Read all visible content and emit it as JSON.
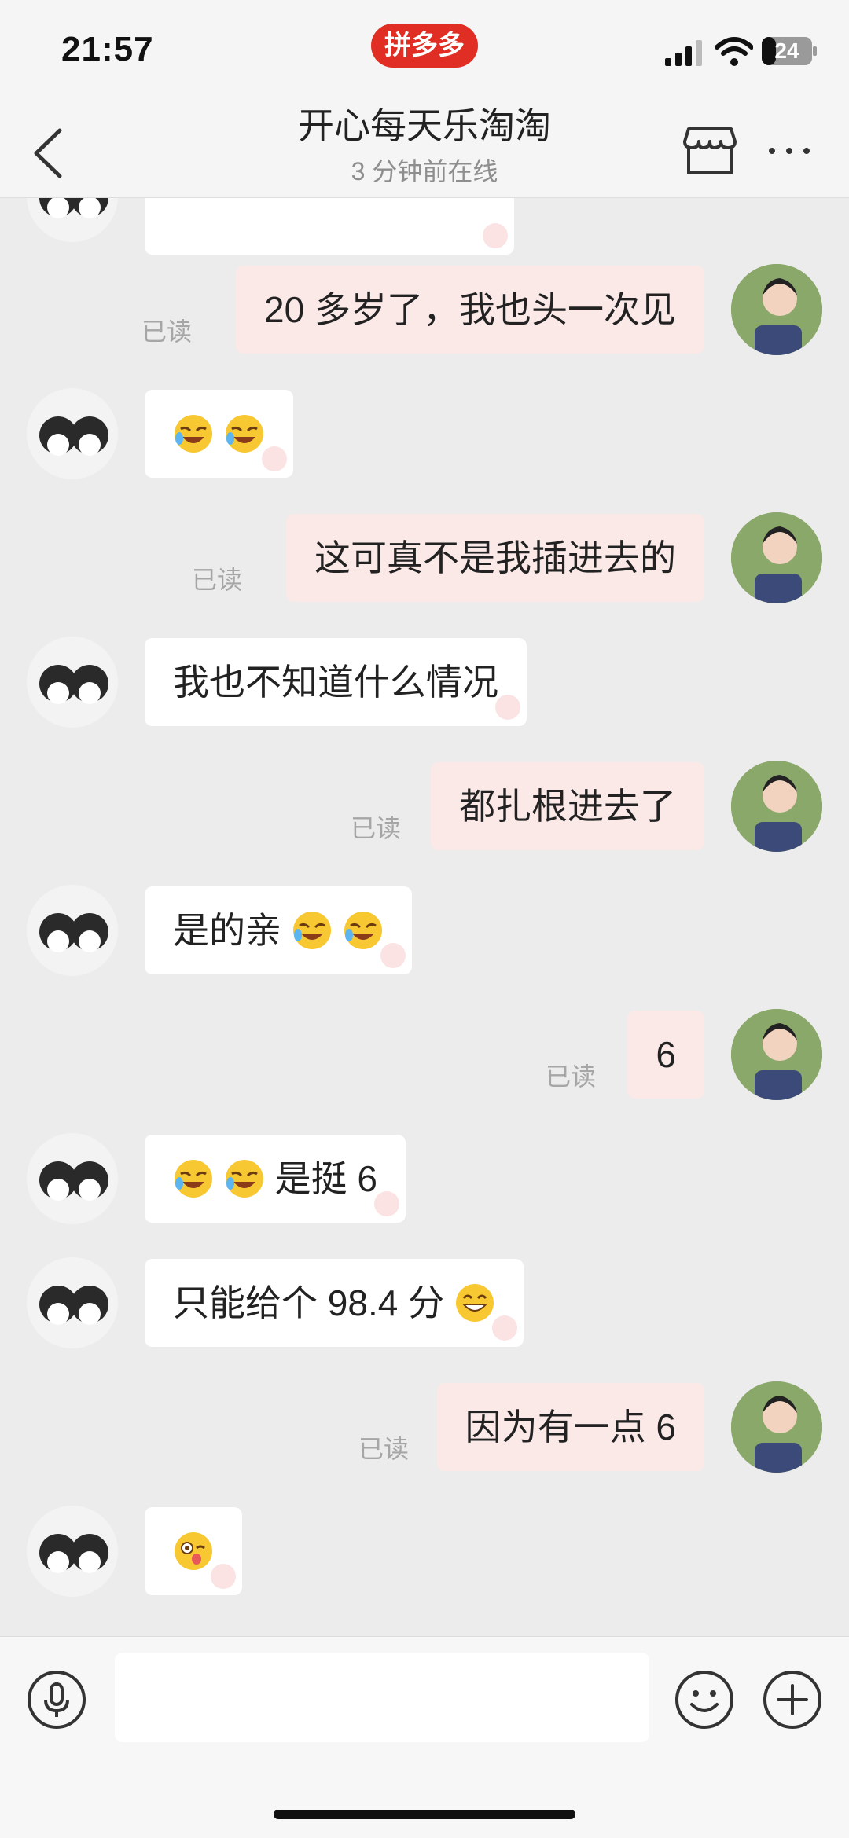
{
  "status_bar": {
    "time": "21:57",
    "app_badge": "拼多多",
    "battery_level": "24",
    "icons": [
      "signal-icon",
      "wifi-icon",
      "battery-icon"
    ]
  },
  "nav": {
    "back_icon": "back-chevron-icon",
    "title": "开心每天乐淘淘",
    "status": "3 分钟前在线",
    "store_icon": "store-icon",
    "more_icon": "more-icon"
  },
  "chat": {
    "read_label": "已读",
    "messages": [
      {
        "side": "in",
        "text": "",
        "emoji": [],
        "partial": true
      },
      {
        "side": "out",
        "text": "20 多岁了，我也头一次见",
        "read": true
      },
      {
        "side": "in",
        "text": "",
        "emoji": [
          "crying-laughing-emoji",
          "crying-laughing-emoji"
        ]
      },
      {
        "side": "out",
        "text": "这可真不是我插进去的",
        "read": true
      },
      {
        "side": "in",
        "text": "我也不知道什么情况",
        "emoji": []
      },
      {
        "side": "out",
        "text": "都扎根进去了",
        "read": true
      },
      {
        "side": "in",
        "text": "是的亲",
        "emoji": [
          "crying-laughing-emoji",
          "crying-laughing-emoji"
        ]
      },
      {
        "side": "out",
        "text": "6",
        "read": true
      },
      {
        "side": "in",
        "text": "是挺 6",
        "emoji_before": [
          "crying-laughing-emoji",
          "crying-laughing-emoji"
        ]
      },
      {
        "side": "in",
        "text": "只能给个 98.4 分",
        "emoji": [
          "grinning-emoji"
        ]
      },
      {
        "side": "out",
        "text": "因为有一点 6",
        "read": true
      },
      {
        "side": "in",
        "text": "",
        "emoji": [
          "wink-tongue-emoji"
        ]
      }
    ]
  },
  "input_bar": {
    "mic_icon": "microphone-icon",
    "input_value": "",
    "input_placeholder": "",
    "emoji_icon": "smiley-icon",
    "plus_icon": "plus-icon"
  },
  "colors": {
    "brand_red": "#e02e24",
    "outgoing_bubble": "#fbe9e8",
    "incoming_bubble": "#ffffff",
    "chat_background": "#ececec"
  }
}
